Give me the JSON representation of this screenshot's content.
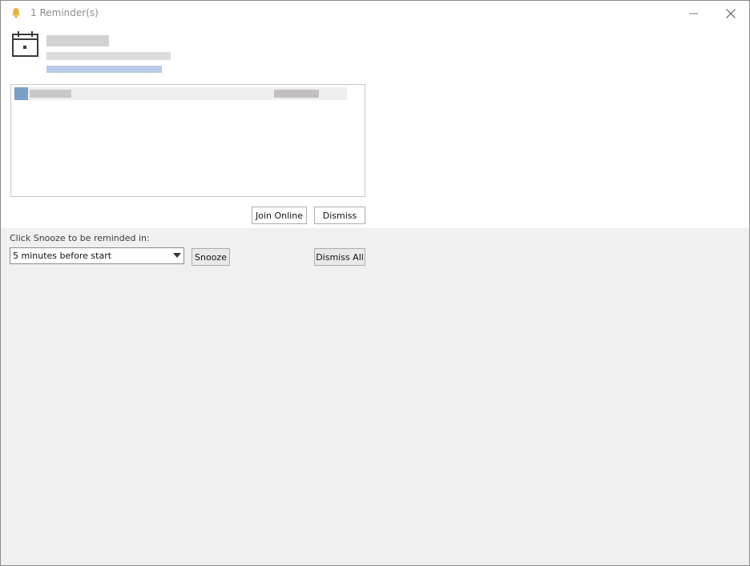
{
  "window": {
    "title": "1 Reminder(s)",
    "accent_bell_color": "#e8b33b"
  },
  "actions": {
    "join_online_label": "Join Online",
    "dismiss_label": "Dismiss"
  },
  "snooze": {
    "label": "Click Snooze to be reminded in:",
    "selected_option": "5 minutes before start",
    "snooze_button_label": "Snooze",
    "dismiss_all_label": "Dismiss All"
  }
}
